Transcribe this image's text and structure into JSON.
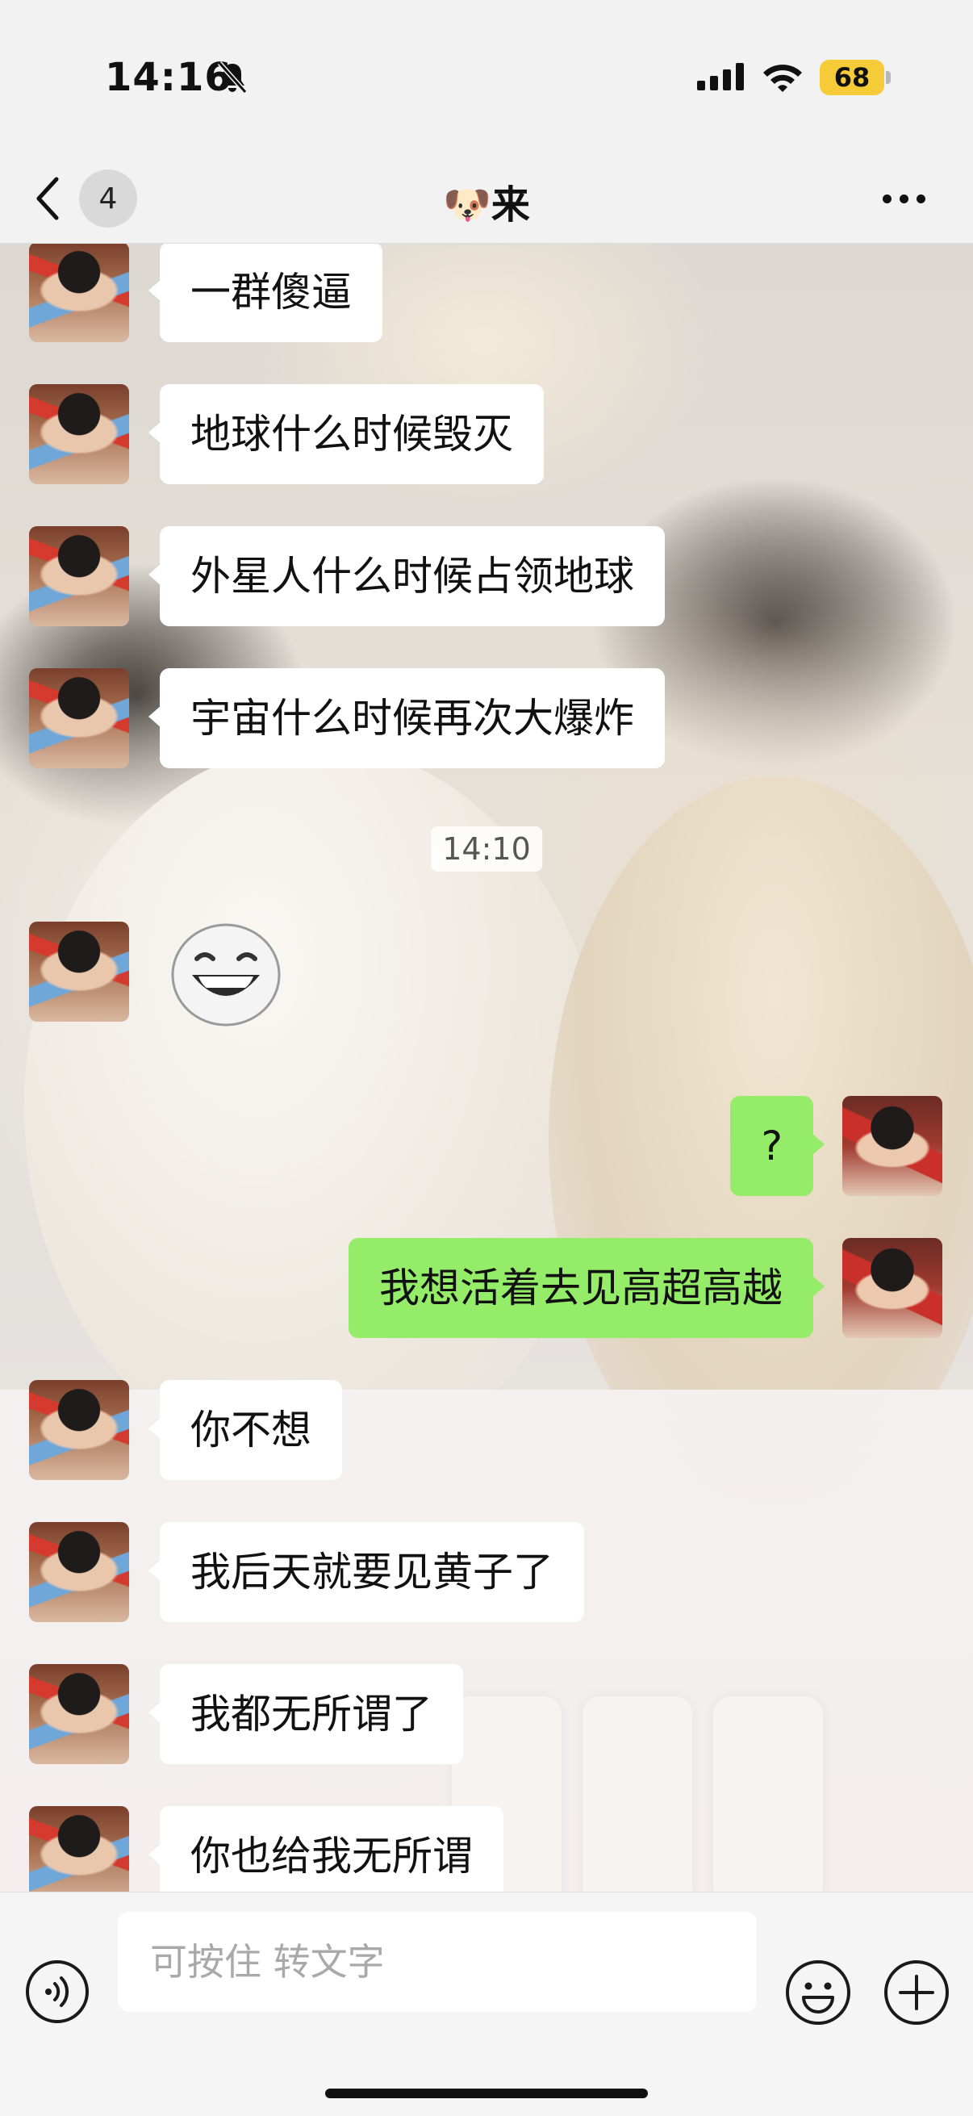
{
  "status_bar": {
    "time": "14:16",
    "battery": "68",
    "battery_color": "#f5cc37"
  },
  "nav": {
    "unread_count": "4",
    "title": "🐶来"
  },
  "messages": [
    {
      "side": "left",
      "type": "text",
      "text": "一群傻逼"
    },
    {
      "side": "left",
      "type": "text",
      "text": "地球什么时候毁灭"
    },
    {
      "side": "left",
      "type": "text",
      "text": "外星人什么时候占领地球"
    },
    {
      "side": "left",
      "type": "text",
      "text": "宇宙什么时候再次大爆炸"
    },
    {
      "type": "timestamp",
      "text": "14:10"
    },
    {
      "side": "left",
      "type": "sticker",
      "icon": "grinning-face-sticker"
    },
    {
      "side": "right",
      "type": "text",
      "text": "?"
    },
    {
      "side": "right",
      "type": "text",
      "text": "我想活着去见高超高越"
    },
    {
      "side": "left",
      "type": "text",
      "text": "你不想"
    },
    {
      "side": "left",
      "type": "text",
      "text": "我后天就要见黄子了"
    },
    {
      "side": "left",
      "type": "text",
      "text": "我都无所谓了"
    },
    {
      "side": "left",
      "type": "text",
      "text": "你也给我无所谓"
    }
  ],
  "input": {
    "placeholder": "可按住 转文字"
  },
  "colors": {
    "outgoing_bubble": "#95ec69",
    "incoming_bubble": "#ffffff",
    "bar_background": "#f5f5f5"
  }
}
